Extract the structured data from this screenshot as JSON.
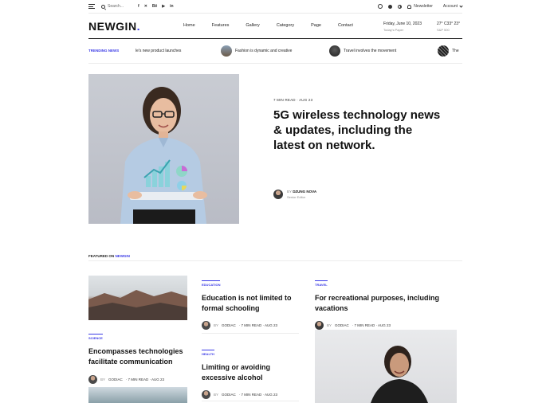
{
  "topbar": {
    "search_placeholder": "Search...",
    "socials": [
      "f",
      "✕",
      "Bē",
      "▶",
      "in"
    ],
    "newsletter": "Newsletter",
    "account": "Account"
  },
  "header": {
    "logo": "NEWGIN",
    "logo_dot": ".",
    "nav": [
      "Home",
      "Features",
      "Gallery",
      "Category",
      "Page",
      "Contact"
    ],
    "date": "Friday, June 10, 2023",
    "date_sub": "Today's Paper",
    "weather": "27° C33° 23°",
    "weather_sub": "S&P 500"
  },
  "trending": {
    "label": "TRENDING NEWS",
    "items": [
      "le's new product launches",
      "Fashion is dynamic and creative",
      "Travel involves the movement",
      "The"
    ]
  },
  "hero": {
    "meta": "7 MIN READ · AUG 23",
    "title": "5G wireless technology news & updates, including the latest on network.",
    "author_by": "BY",
    "author_name": "DZUNG NOVA",
    "author_role": "Senior Editor"
  },
  "featured": {
    "label": "FEATURED ON",
    "brand": "NEWGIN"
  },
  "cards": [
    {
      "category": "SCIENCE",
      "title": "Encompasses technologies facilitate communication",
      "by": "BY",
      "author": "GODIAC",
      "meta": "· 7 MIN READ · AUG 23"
    },
    {
      "category": "EDUCATION",
      "title": "Education is not limited to formal schooling",
      "by": "BY",
      "author": "GODIAC",
      "meta": "· 7 MIN READ · AUG 23"
    },
    {
      "category": "HEALTH",
      "title": "Limiting or avoiding excessive alcohol",
      "by": "BY",
      "author": "GODIAC",
      "meta": "· 7 MIN READ · AUG 23"
    },
    {
      "category": "TRAVEL",
      "title": "For recreational purposes, including vacations",
      "by": "BY",
      "author": "GODIAC",
      "meta": "· 7 MIN READ · AUG 23"
    }
  ],
  "colors": {
    "accent": "#3b3be6",
    "text": "#111111"
  }
}
